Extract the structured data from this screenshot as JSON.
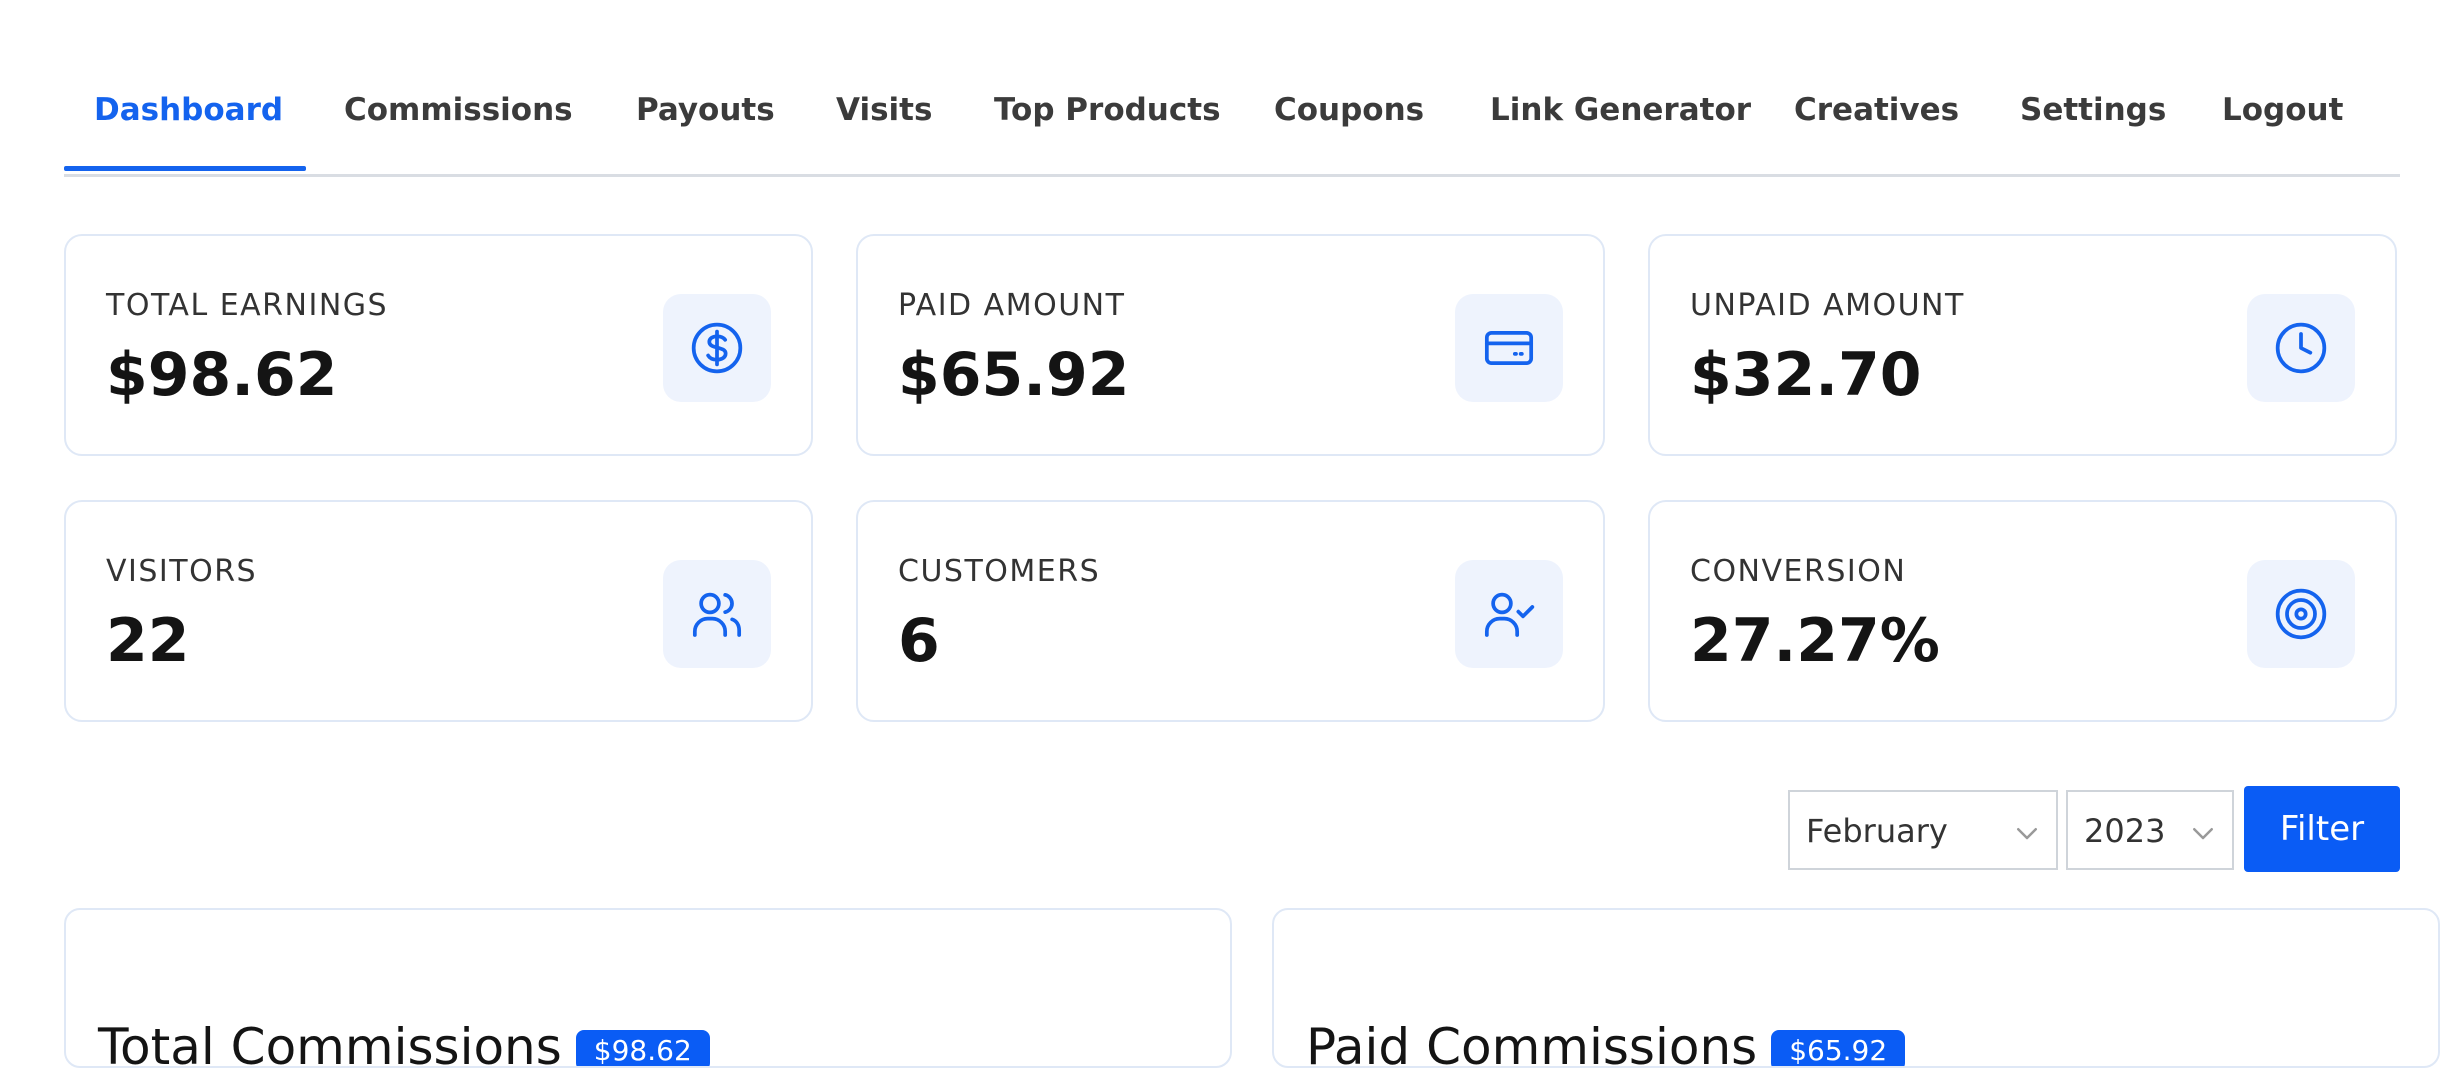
{
  "nav": {
    "tabs": [
      {
        "label": "Dashboard"
      },
      {
        "label": "Commissions"
      },
      {
        "label": "Payouts"
      },
      {
        "label": "Visits"
      },
      {
        "label": "Top Products"
      },
      {
        "label": "Coupons"
      },
      {
        "label": "Link Generator"
      },
      {
        "label": "Creatives"
      },
      {
        "label": "Settings"
      },
      {
        "label": "Logout"
      }
    ],
    "active_tab": "Dashboard"
  },
  "stats": [
    {
      "label": "TOTAL EARNINGS",
      "value": "$98.62",
      "icon": "dollar-circle-icon"
    },
    {
      "label": "PAID AMOUNT",
      "value": "$65.92",
      "icon": "credit-card-icon"
    },
    {
      "label": "UNPAID AMOUNT",
      "value": "$32.70",
      "icon": "clock-icon"
    },
    {
      "label": "VISITORS",
      "value": "22",
      "icon": "users-icon"
    },
    {
      "label": "CUSTOMERS",
      "value": "6",
      "icon": "user-check-icon"
    },
    {
      "label": "CONVERSION",
      "value": "27.27%",
      "icon": "target-icon"
    }
  ],
  "filter": {
    "month": "February",
    "year": "2023",
    "button_label": "Filter"
  },
  "panels": {
    "total_commissions": {
      "title": "Total Commissions",
      "badge": "$98.62"
    },
    "paid_commissions": {
      "title": "Paid Commissions",
      "badge": "$65.92"
    }
  },
  "colors": {
    "accent": "#1463ee",
    "button": "#0a5cf5",
    "icon_bg": "#eef3fd",
    "card_border": "#dfe8f6"
  }
}
